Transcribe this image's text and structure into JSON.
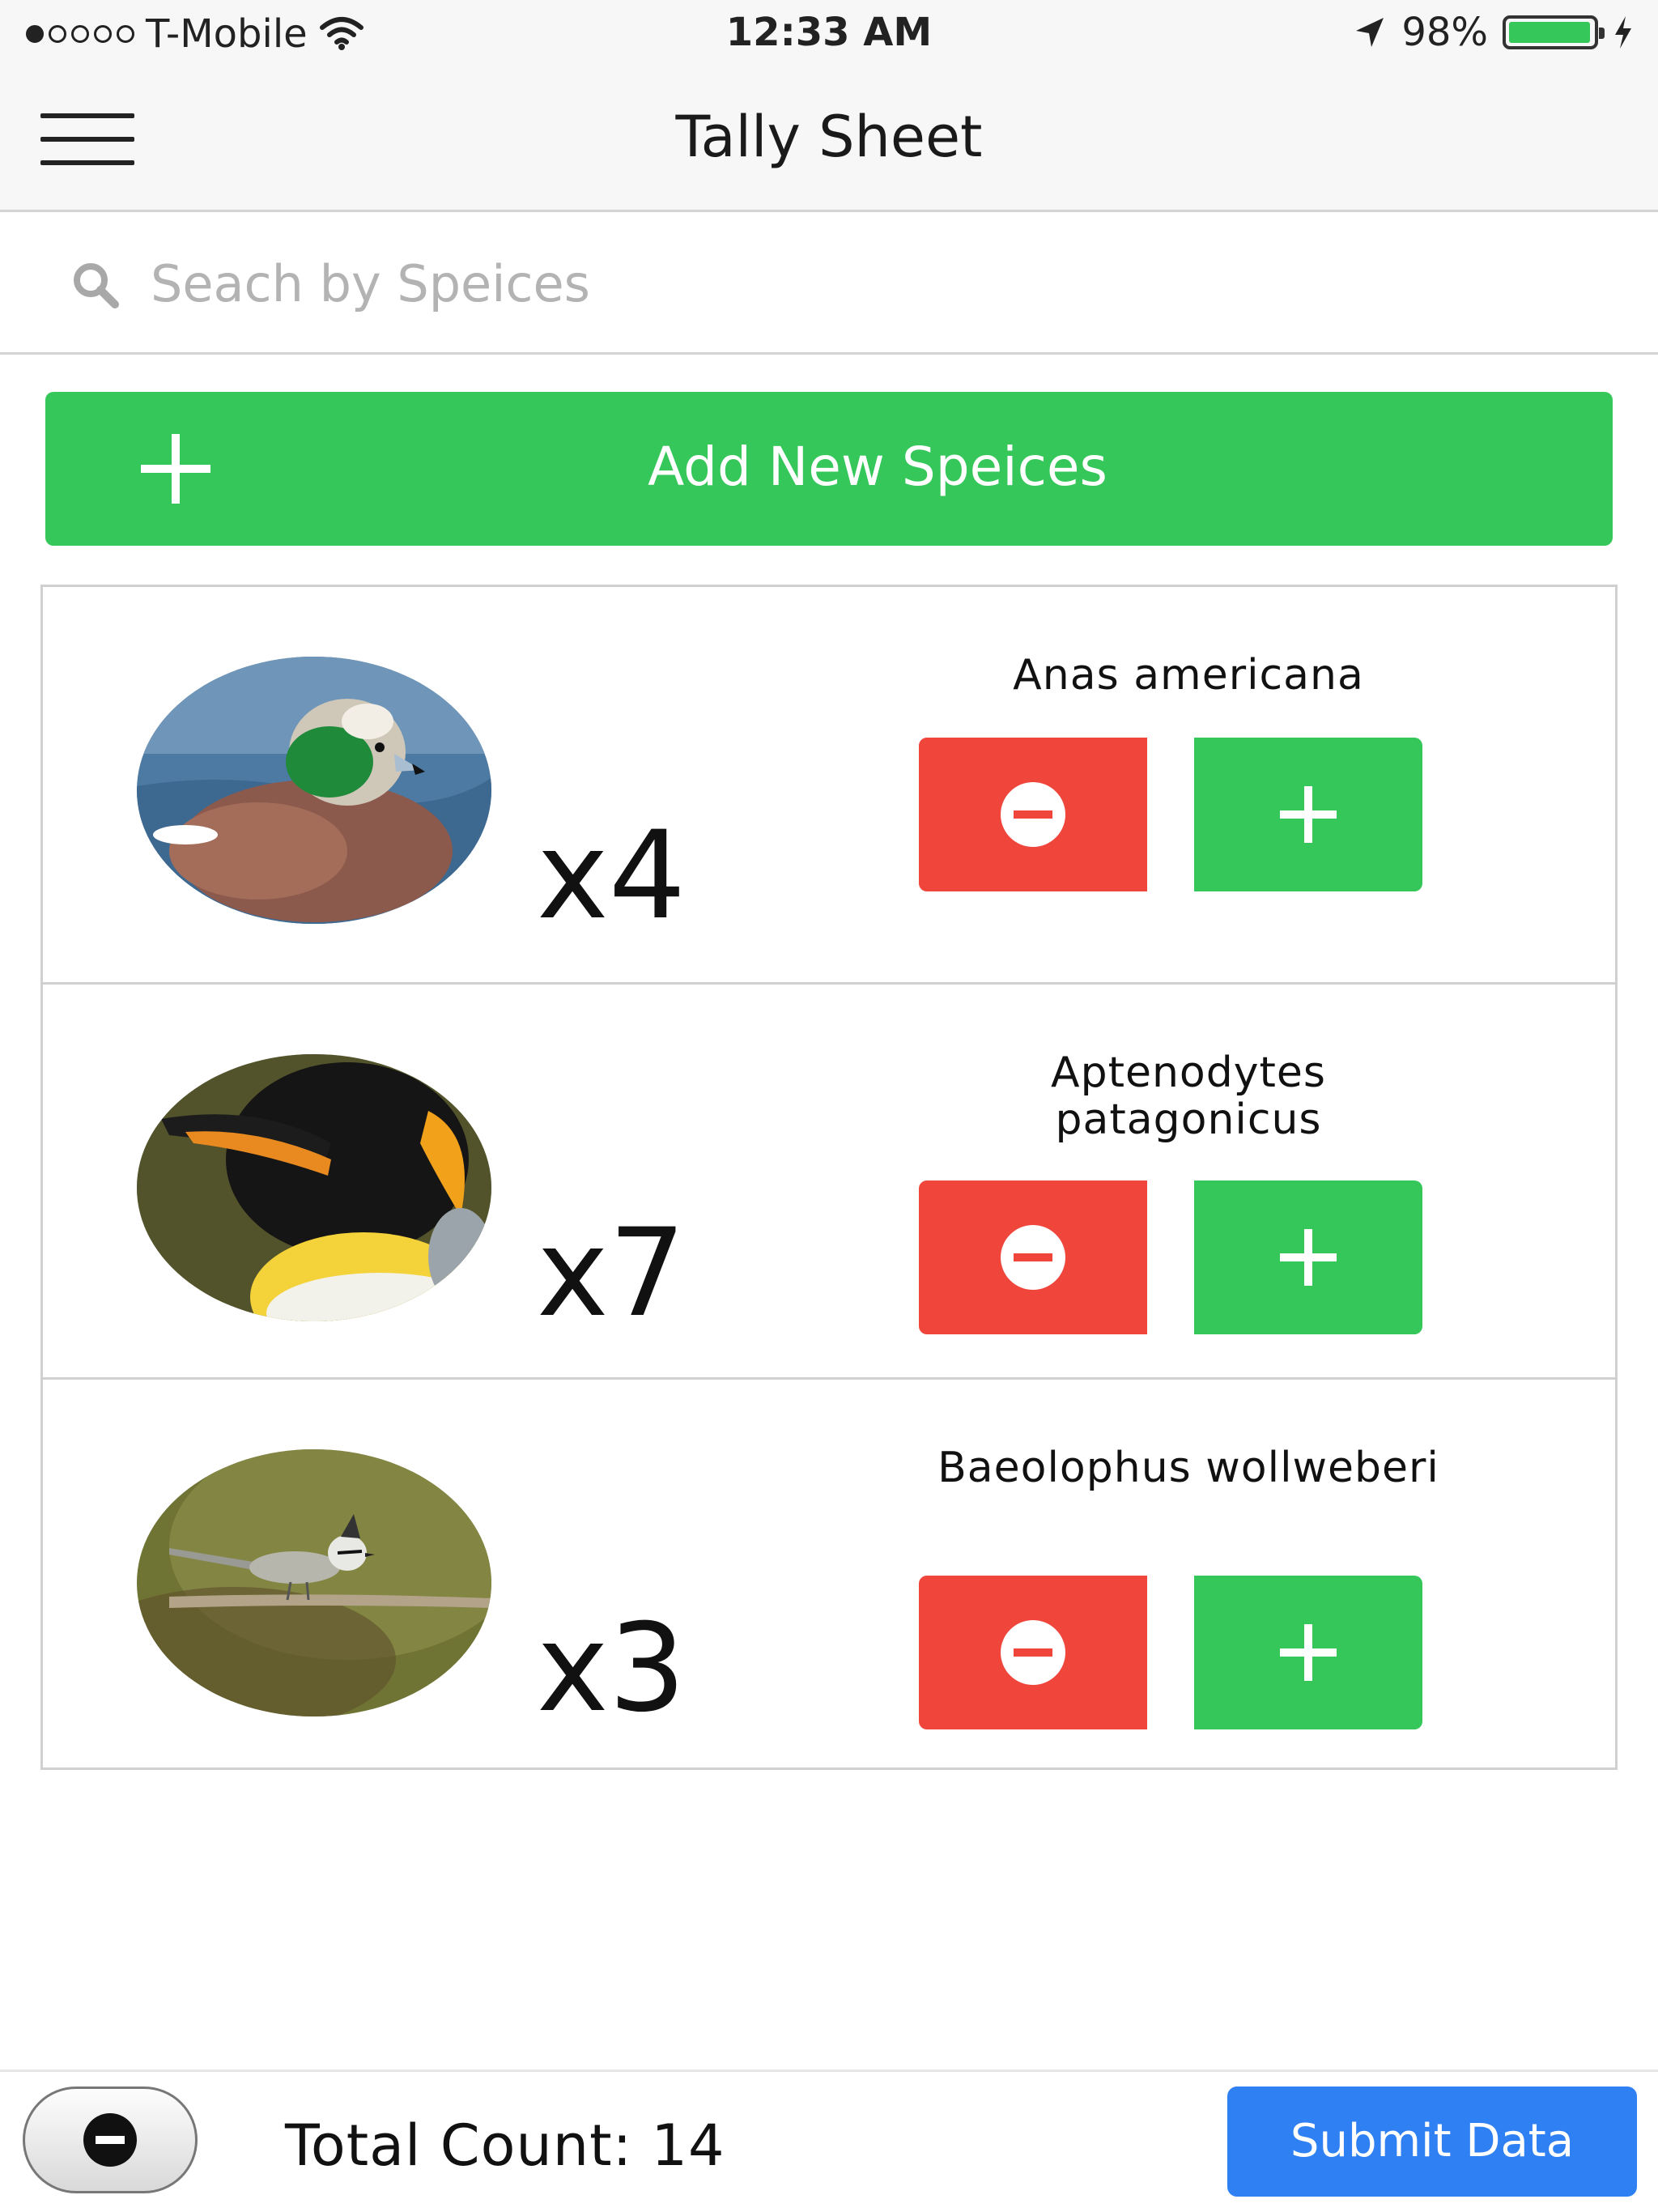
{
  "status_bar": {
    "carrier": "T-Mobile",
    "time": "12:33 AM",
    "battery": "98%",
    "battery_level": 0.98,
    "icons": [
      "signal-dots-icon",
      "wifi-icon",
      "location-arrow-icon",
      "battery-icon",
      "charging-bolt-icon"
    ]
  },
  "nav": {
    "title": "Tally Sheet",
    "menu_icon": "hamburger-menu-icon"
  },
  "search": {
    "placeholder": "Seach by Speices",
    "value": "",
    "icon": "search-icon"
  },
  "add_button": {
    "label": "Add New Speices",
    "icon": "plus-icon"
  },
  "species": [
    {
      "name": "Anas americana",
      "count": "x4",
      "photo": "american-wigeon-photo"
    },
    {
      "name": "Aptenodytes patagonicus",
      "count": "x7",
      "photo": "king-penguin-photo"
    },
    {
      "name": "Baeolophus wollweberi",
      "count": "x3",
      "photo": "bridled-titmouse-photo"
    }
  ],
  "footer": {
    "total_count": "Total Count: 14",
    "submit_label": "Submit Data",
    "remove_toggle_icon": "minus-circle-icon"
  },
  "colors": {
    "accent_green": "#35c759",
    "decrement_red": "#ef453b",
    "submit_blue": "#2f80f3",
    "bar_background": "#f7f7f7"
  }
}
